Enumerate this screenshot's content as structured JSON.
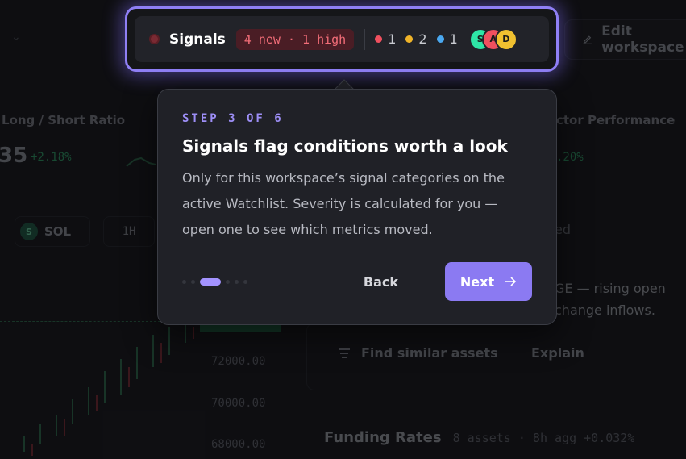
{
  "background": {
    "edit_label": "Edit workspace",
    "metrics": [
      {
        "label": "Long / Short Ratio",
        "value": "35",
        "change": "+2.18%"
      }
    ],
    "right_header": "ctor Performance",
    "right_change": ".20%",
    "chip_sol": {
      "icon_letter": "S",
      "label": "SOL"
    },
    "chip_timeframe": "1H",
    "price_labels": [
      "72000.00",
      "70000.00",
      "68000.00"
    ],
    "right_panel_lines": [
      "ed",
      "GE — rising open",
      "change inflows."
    ],
    "find_similar_label": "Find similar assets",
    "explain_label": "Explain",
    "funding": {
      "title": "Funding Rates",
      "meta": "8 assets · 8h  agg +0.032%"
    }
  },
  "signals": {
    "label": "Signals",
    "badge": "4 new · 1 high",
    "severity": [
      {
        "count": "1",
        "color": "#f0505f"
      },
      {
        "count": "2",
        "color": "#f0b429"
      },
      {
        "count": "1",
        "color": "#4aa8f0"
      }
    ],
    "avatars": [
      {
        "letter": "S",
        "color": "#2ee6a6"
      },
      {
        "letter": "A",
        "color": "#f0505f"
      },
      {
        "letter": "D",
        "color": "#f0c030"
      }
    ]
  },
  "tour": {
    "step": "STEP 3 OF 6",
    "title": "Signals flag conditions worth a look",
    "body": "Only for this workspace’s signal categories on the active Watchlist. Severity is calculated for you — open one to see which metrics moved.",
    "back_label": "Back",
    "next_label": "Next",
    "current_step": 3,
    "total_steps": 6
  },
  "colors": {
    "accent": "#8b7af2"
  }
}
